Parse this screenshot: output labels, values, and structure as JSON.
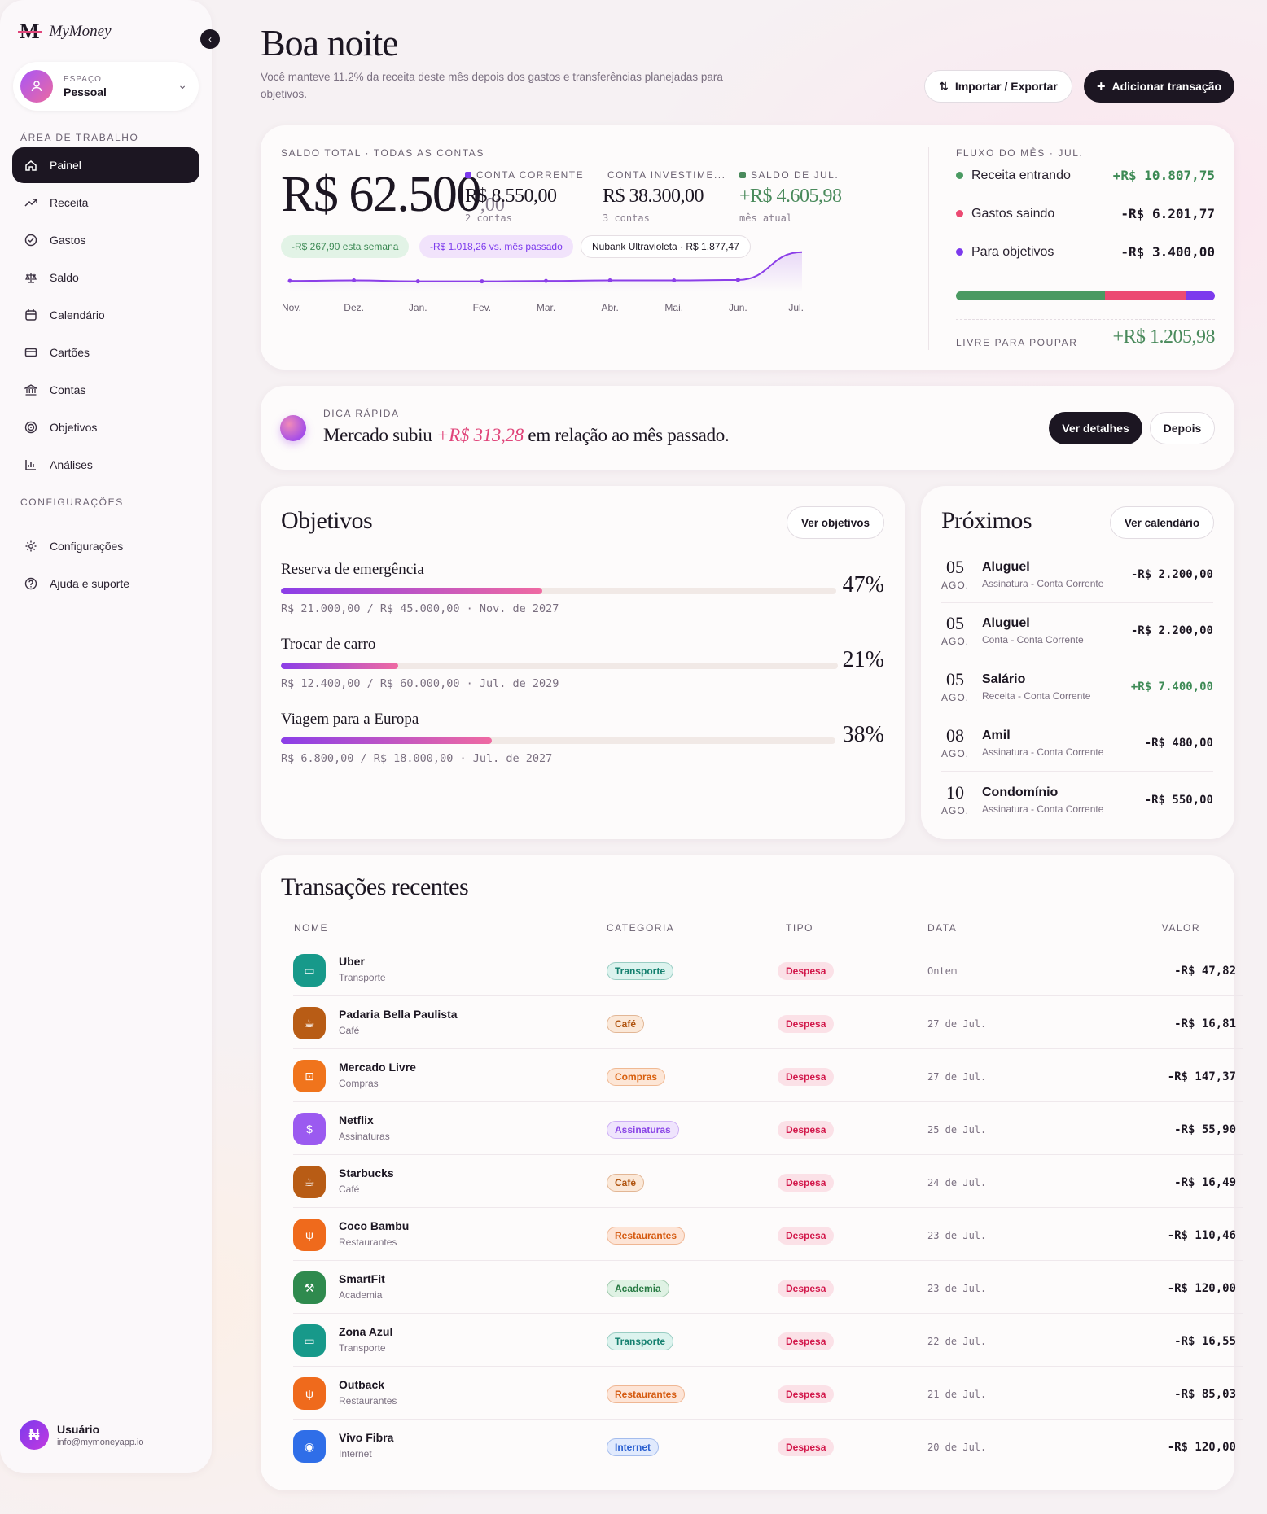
{
  "app": {
    "logo_mark": "M",
    "name": "MyMoney"
  },
  "workspace": {
    "label": "ESPAÇO",
    "value": "Pessoal"
  },
  "nav": {
    "section1": "ÁREA DE TRABALHO",
    "items": [
      {
        "label": "Painel",
        "icon": "home-icon"
      },
      {
        "label": "Receita",
        "icon": "trending-up-icon"
      },
      {
        "label": "Gastos",
        "icon": "check-circle-icon"
      },
      {
        "label": "Saldo",
        "icon": "scale-icon"
      },
      {
        "label": "Calendário",
        "icon": "calendar-icon"
      },
      {
        "label": "Cartões",
        "icon": "credit-card-icon"
      },
      {
        "label": "Contas",
        "icon": "bank-icon"
      },
      {
        "label": "Objetivos",
        "icon": "target-icon"
      },
      {
        "label": "Análises",
        "icon": "bar-chart-icon"
      }
    ],
    "section2": "CONFIGURAÇÕES",
    "settings": [
      {
        "label": "Configurações",
        "icon": "gear-icon"
      },
      {
        "label": "Ajuda e suporte",
        "icon": "help-icon"
      }
    ]
  },
  "user": {
    "avatar": "₦",
    "name": "Usuário",
    "email": "info@mymoneyapp.io"
  },
  "header": {
    "greeting": "Boa noite",
    "subtitle": "Você manteve 11.2% da receita deste mês depois dos gastos e transferências planejadas para objetivos.",
    "import_label": "Importar / Exportar",
    "add_label": "Adicionar transação"
  },
  "balance": {
    "label": "SALDO TOTAL · TODAS AS CONTAS",
    "main": "R$ 62.500",
    "cents": ",00",
    "accounts": [
      {
        "label": "CONTA CORRENTE",
        "value": "R$ 8.550,00",
        "sub": "2 contas",
        "color": "#7c3aed"
      },
      {
        "label": "CONTA INVESTIME...",
        "value": "R$ 38.300,00",
        "sub": "3 contas",
        "color": "#4a8a5c"
      },
      {
        "label": "SALDO DE JUL.",
        "value": "+R$ 4.605,98",
        "sub": "mês atual",
        "color": "#4a8a5c"
      }
    ],
    "pills": [
      "-R$ 267,90 esta semana",
      "-R$ 1.018,26 vs. mês passado",
      "Nubank Ultravioleta · R$ 1.877,47"
    ]
  },
  "chart_data": {
    "type": "line",
    "categories": [
      "Nov.",
      "Dez.",
      "Jan.",
      "Fev.",
      "Mar.",
      "Abr.",
      "Mai.",
      "Jun.",
      "Jul."
    ],
    "values": [
      56400,
      56500,
      56300,
      56300,
      56400,
      56500,
      56500,
      56600,
      62500
    ],
    "ylim": [
      54000,
      63500
    ]
  },
  "flow": {
    "label": "FLUXO DO MÊS · JUL.",
    "rows": [
      {
        "label": "Receita entrando",
        "value": "+R$ 10.807,75",
        "color": "#4a9a62"
      },
      {
        "label": "Gastos saindo",
        "value": "-R$ 6.201,77",
        "color": "#ec4a72"
      },
      {
        "label": "Para objetivos",
        "value": "-R$ 3.400,00",
        "color": "#7c3aed"
      }
    ],
    "bar": [
      0.574,
      0.315,
      0.111
    ],
    "free_label": "LIVRE PARA POUPAR",
    "free_value": "+R$ 1.205,98"
  },
  "tip": {
    "label": "DICA RÁPIDA",
    "text_before": "Mercado subiu ",
    "highlight": "+R$ 313,28",
    "text_after": " em relação ao mês passado.",
    "details_label": "Ver detalhes",
    "later_label": "Depois"
  },
  "goals": {
    "title": "Objetivos",
    "button": "Ver objetivos",
    "items": [
      {
        "name": "Reserva de emergência",
        "progress": 0.47,
        "pct": "47%",
        "meta": "R$ 21.000,00 / R$ 45.000,00 · Nov. de 2027"
      },
      {
        "name": "Trocar de carro",
        "progress": 0.21,
        "pct": "21%",
        "meta": "R$ 12.400,00 / R$ 60.000,00 · Jul. de 2029"
      },
      {
        "name": "Viagem para a Europa",
        "progress": 0.38,
        "pct": "38%",
        "meta": "R$ 6.800,00 / R$ 18.000,00 · Jul. de 2027"
      }
    ]
  },
  "upcoming": {
    "title": "Próximos",
    "button": "Ver calendário",
    "items": [
      {
        "day": "05",
        "month": "AGO.",
        "name": "Aluguel",
        "sub": "Assinatura - Conta Corrente",
        "amount": "-R$ 2.200,00",
        "color": "#1c1622"
      },
      {
        "day": "05",
        "month": "AGO.",
        "name": "Aluguel",
        "sub": "Conta - Conta Corrente",
        "amount": "-R$ 2.200,00",
        "color": "#1c1622"
      },
      {
        "day": "05",
        "month": "AGO.",
        "name": "Salário",
        "sub": "Receita - Conta Corrente",
        "amount": "+R$ 7.400,00",
        "color": "#3d8a55"
      },
      {
        "day": "08",
        "month": "AGO.",
        "name": "Amil",
        "sub": "Assinatura - Conta Corrente",
        "amount": "-R$ 480,00",
        "color": "#1c1622"
      },
      {
        "day": "10",
        "month": "AGO.",
        "name": "Condomínio",
        "sub": "Assinatura - Conta Corrente",
        "amount": "-R$ 550,00",
        "color": "#1c1622"
      }
    ]
  },
  "transactions": {
    "title": "Transações recentes",
    "headers": {
      "name": "NOME",
      "category": "CATEGORIA",
      "type": "TIPO",
      "date": "DATA",
      "value": "VALOR"
    },
    "rows": [
      {
        "name": "Uber",
        "sub": "Transporte",
        "category": "Transporte",
        "type": "Despesa",
        "date": "Ontem",
        "value": "-R$ 47,82",
        "icon": "bus-icon",
        "glyph": "▭",
        "bg": "#17998a",
        "cbg": "#dcf3ee",
        "cfg": "#15806f"
      },
      {
        "name": "Padaria Bella Paulista",
        "sub": "Café",
        "category": "Café",
        "type": "Despesa",
        "date": "27 de Jul.",
        "value": "-R$ 16,81",
        "icon": "coffee-icon",
        "glyph": "☕",
        "bg": "#b85c15",
        "cbg": "#fbe8d8",
        "cfg": "#b05410"
      },
      {
        "name": "Mercado Livre",
        "sub": "Compras",
        "category": "Compras",
        "type": "Despesa",
        "date": "27 de Jul.",
        "value": "-R$ 147,37",
        "icon": "shopping-bag-icon",
        "glyph": "⊡",
        "bg": "#f0741c",
        "cbg": "#fde6d6",
        "cfg": "#d8600e"
      },
      {
        "name": "Netflix",
        "sub": "Assinaturas",
        "category": "Assinaturas",
        "type": "Despesa",
        "date": "25 de Jul.",
        "value": "-R$ 55,90",
        "icon": "subscription-icon",
        "glyph": "$",
        "bg": "#9b5af0",
        "cbg": "#efe4fd",
        "cfg": "#8a45e6"
      },
      {
        "name": "Starbucks",
        "sub": "Café",
        "category": "Café",
        "type": "Despesa",
        "date": "24 de Jul.",
        "value": "-R$ 16,49",
        "icon": "coffee-icon",
        "glyph": "☕",
        "bg": "#b85c15",
        "cbg": "#fbe8d8",
        "cfg": "#b05410"
      },
      {
        "name": "Coco Bambu",
        "sub": "Restaurantes",
        "category": "Restaurantes",
        "type": "Despesa",
        "date": "23 de Jul.",
        "value": "-R$ 110,46",
        "icon": "utensils-icon",
        "glyph": "ψ",
        "bg": "#ef6a1c",
        "cbg": "#fde4d6",
        "cfg": "#d55a10"
      },
      {
        "name": "SmartFit",
        "sub": "Academia",
        "category": "Academia",
        "type": "Despesa",
        "date": "23 de Jul.",
        "value": "-R$ 120,00",
        "icon": "dumbbell-icon",
        "glyph": "⚒",
        "bg": "#2f8a4e",
        "cbg": "#dff2e4",
        "cfg": "#277a43"
      },
      {
        "name": "Zona Azul",
        "sub": "Transporte",
        "category": "Transporte",
        "type": "Despesa",
        "date": "22 de Jul.",
        "value": "-R$ 16,55",
        "icon": "bus-icon",
        "glyph": "▭",
        "bg": "#17998a",
        "cbg": "#dcf3ee",
        "cfg": "#15806f"
      },
      {
        "name": "Outback",
        "sub": "Restaurantes",
        "category": "Restaurantes",
        "type": "Despesa",
        "date": "21 de Jul.",
        "value": "-R$ 85,03",
        "icon": "utensils-icon",
        "glyph": "ψ",
        "bg": "#ef6a1c",
        "cbg": "#fde4d6",
        "cfg": "#d55a10"
      },
      {
        "name": "Vivo Fibra",
        "sub": "Internet",
        "category": "Internet",
        "type": "Despesa",
        "date": "20 de Jul.",
        "value": "-R$ 120,00",
        "icon": "wifi-icon",
        "glyph": "◉",
        "bg": "#2f6ee8",
        "cbg": "#e1eafd",
        "cfg": "#2a5fd0"
      }
    ]
  }
}
